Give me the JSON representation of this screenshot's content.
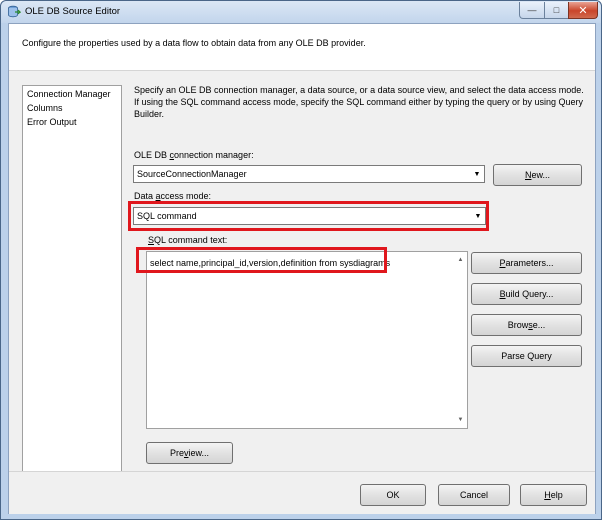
{
  "window": {
    "title": "OLE DB Source Editor",
    "controls": {
      "minimize": "—",
      "maximize": "□",
      "close": "✕"
    }
  },
  "header": {
    "description": "Configure the properties used by a data flow to obtain data from any OLE DB provider."
  },
  "nav": {
    "items": [
      {
        "label": "Connection Manager"
      },
      {
        "label": "Columns"
      },
      {
        "label": "Error Output"
      }
    ]
  },
  "main": {
    "instructions": "Specify an OLE DB connection manager, a data source, or a data source view, and select the data access mode. If using the SQL command access mode, specify the SQL command either by typing the query or by using Query Builder.",
    "connection_manager": {
      "label_before": "OLE DB ",
      "label_underlined": "c",
      "label_after": "onnection manager:",
      "value": "SourceConnectionManager"
    },
    "data_access_mode": {
      "label_before": "Data ",
      "label_underlined": "a",
      "label_after": "ccess mode:",
      "value": "SQL command"
    },
    "sql_command": {
      "label_underlined": "S",
      "label_after": "QL command text:",
      "value": "select name,principal_id,version,definition from sysdiagrams"
    }
  },
  "buttons": {
    "new_underlined": "N",
    "new_after": "ew...",
    "parameters_underlined": "P",
    "parameters_after": "arameters...",
    "build_query_underlined": "B",
    "build_query_after": "uild Query...",
    "browse_before": "Brow",
    "browse_underlined": "s",
    "browse_after": "e...",
    "parse_query": "Parse Query",
    "preview_before": "Pre",
    "preview_underlined": "v",
    "preview_after": "iew...",
    "ok": "OK",
    "cancel": "Cancel",
    "help_underlined": "H",
    "help_after": "elp"
  },
  "colors": {
    "highlight": "#e0171d",
    "titlebar": "#c2d5ec",
    "close_button": "#c9452a"
  },
  "icons": {
    "app": "ole-db-source-icon",
    "dropdown": "chevron-down-icon"
  }
}
